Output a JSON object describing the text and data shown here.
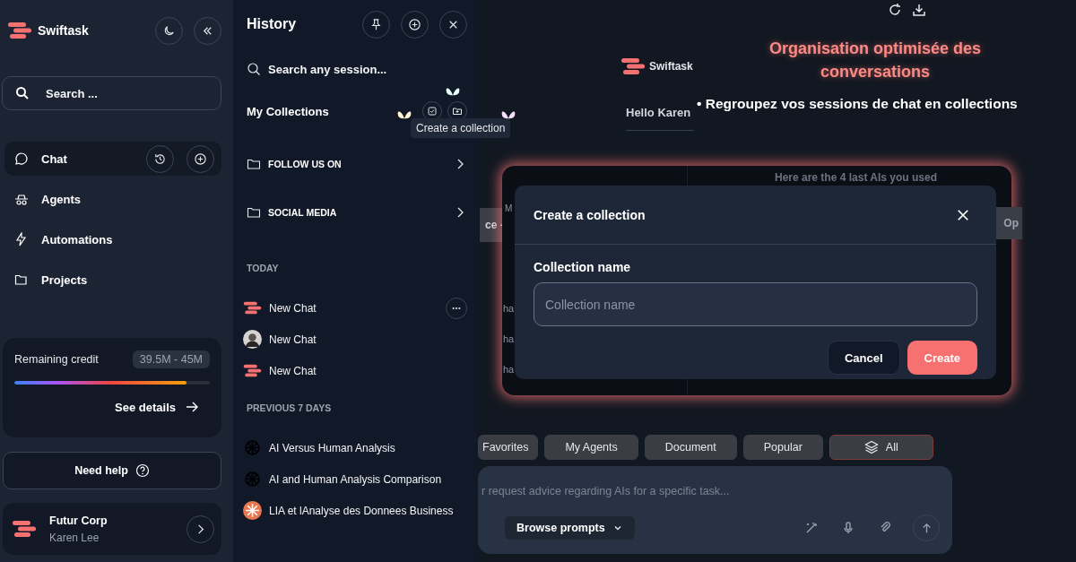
{
  "sidebar": {
    "brand": "Swiftask",
    "search": {
      "placeholder": "Search ..."
    },
    "nav": [
      {
        "label": "Chat",
        "kind": "chat",
        "selected": true
      },
      {
        "label": "Agents",
        "kind": "agents",
        "selected": false
      },
      {
        "label": "Automations",
        "kind": "automations",
        "selected": false
      },
      {
        "label": "Projects",
        "kind": "projects",
        "selected": false
      }
    ],
    "credit": {
      "label": "Remaining credit",
      "amount": "39.5M - 45M",
      "level": 0.88,
      "link": "See details"
    },
    "help": "Need help",
    "account": {
      "name": "Futur Corp",
      "user": "Karen Lee"
    }
  },
  "history": {
    "title": "History",
    "search": {
      "placeholder": "Search any session..."
    },
    "collections_title": "My Collections",
    "tooltip": "Create a collection",
    "folders": [
      {
        "label": "FOLLOW US ON"
      },
      {
        "label": "SOCIAL MEDIA"
      }
    ],
    "sections": [
      {
        "title": "TODAY",
        "items": [
          {
            "title": "New Chat",
            "kind": "logo",
            "menu": true
          },
          {
            "title": "New Chat",
            "kind": "avatar",
            "menu": false
          },
          {
            "title": "New Chat",
            "kind": "logo",
            "menu": false
          }
        ]
      },
      {
        "title": "PREVIOUS 7 DAYS",
        "items": [
          {
            "title": "AI Versus Human Analysis",
            "kind": "model",
            "menu": false
          },
          {
            "title": "AI and Human Analysis Comparison",
            "kind": "model",
            "menu": false
          },
          {
            "title": "LIA et lAnalyse des Donnees Business",
            "kind": "spark",
            "menu": false
          }
        ]
      }
    ]
  },
  "main": {
    "headline": "Organisation optimisée des conversations",
    "bullet": "• Regroupez vos sessions de chat en collections",
    "brand": "Swiftask",
    "greeting": "Hello Karen",
    "edge_chip": "ce -",
    "frame_texts": {
      "heading": "Here are the 4 last AIs you used",
      "label": "M",
      "rows": [
        "ha",
        "ha",
        "ha"
      ],
      "chip": "Op"
    },
    "dialog": {
      "title": "Create a collection",
      "field_label": "Collection name",
      "placeholder": "Collection name",
      "buttons": [
        {
          "label": "Cancel",
          "kind": "secondary"
        },
        {
          "label": "Create",
          "kind": "primary"
        }
      ]
    },
    "tabs": [
      {
        "label": "Favorites",
        "kind": "plain",
        "selected": false
      },
      {
        "label": "My Agents",
        "kind": "plain",
        "selected": false
      },
      {
        "label": "Document",
        "kind": "plain",
        "selected": false
      },
      {
        "label": "Popular",
        "kind": "plain",
        "selected": false
      },
      {
        "label": "All",
        "kind": "stack",
        "selected": true
      }
    ],
    "prompt": {
      "placeholder": "r request advice regarding AIs for a specific task...",
      "browse": "Browse prompts"
    }
  }
}
